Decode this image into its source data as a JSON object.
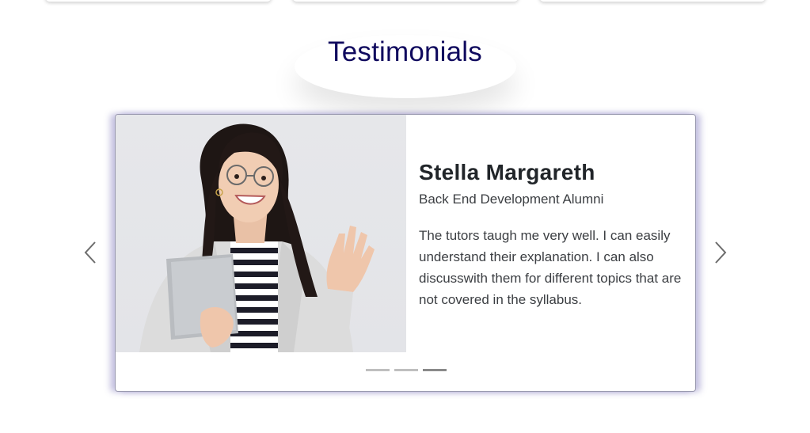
{
  "section": {
    "title": "Testimonials"
  },
  "testimonial": {
    "name": "Stella Margareth",
    "role": "Back End Development Alumni",
    "quote": "The tutors taugh me very well. I can easily understand their explanation. I can also discusswith them for different topics that are not covered in the syllabus."
  },
  "carousel": {
    "slide_count": 3,
    "active_index": 2
  },
  "icons": {
    "prev": "chevron-left-icon",
    "next": "chevron-right-icon"
  },
  "colors": {
    "title": "#100a5e",
    "card_shadow": "#5c54aa",
    "indicator": "#bfbfbf",
    "indicator_active": "#8a8a8a"
  }
}
